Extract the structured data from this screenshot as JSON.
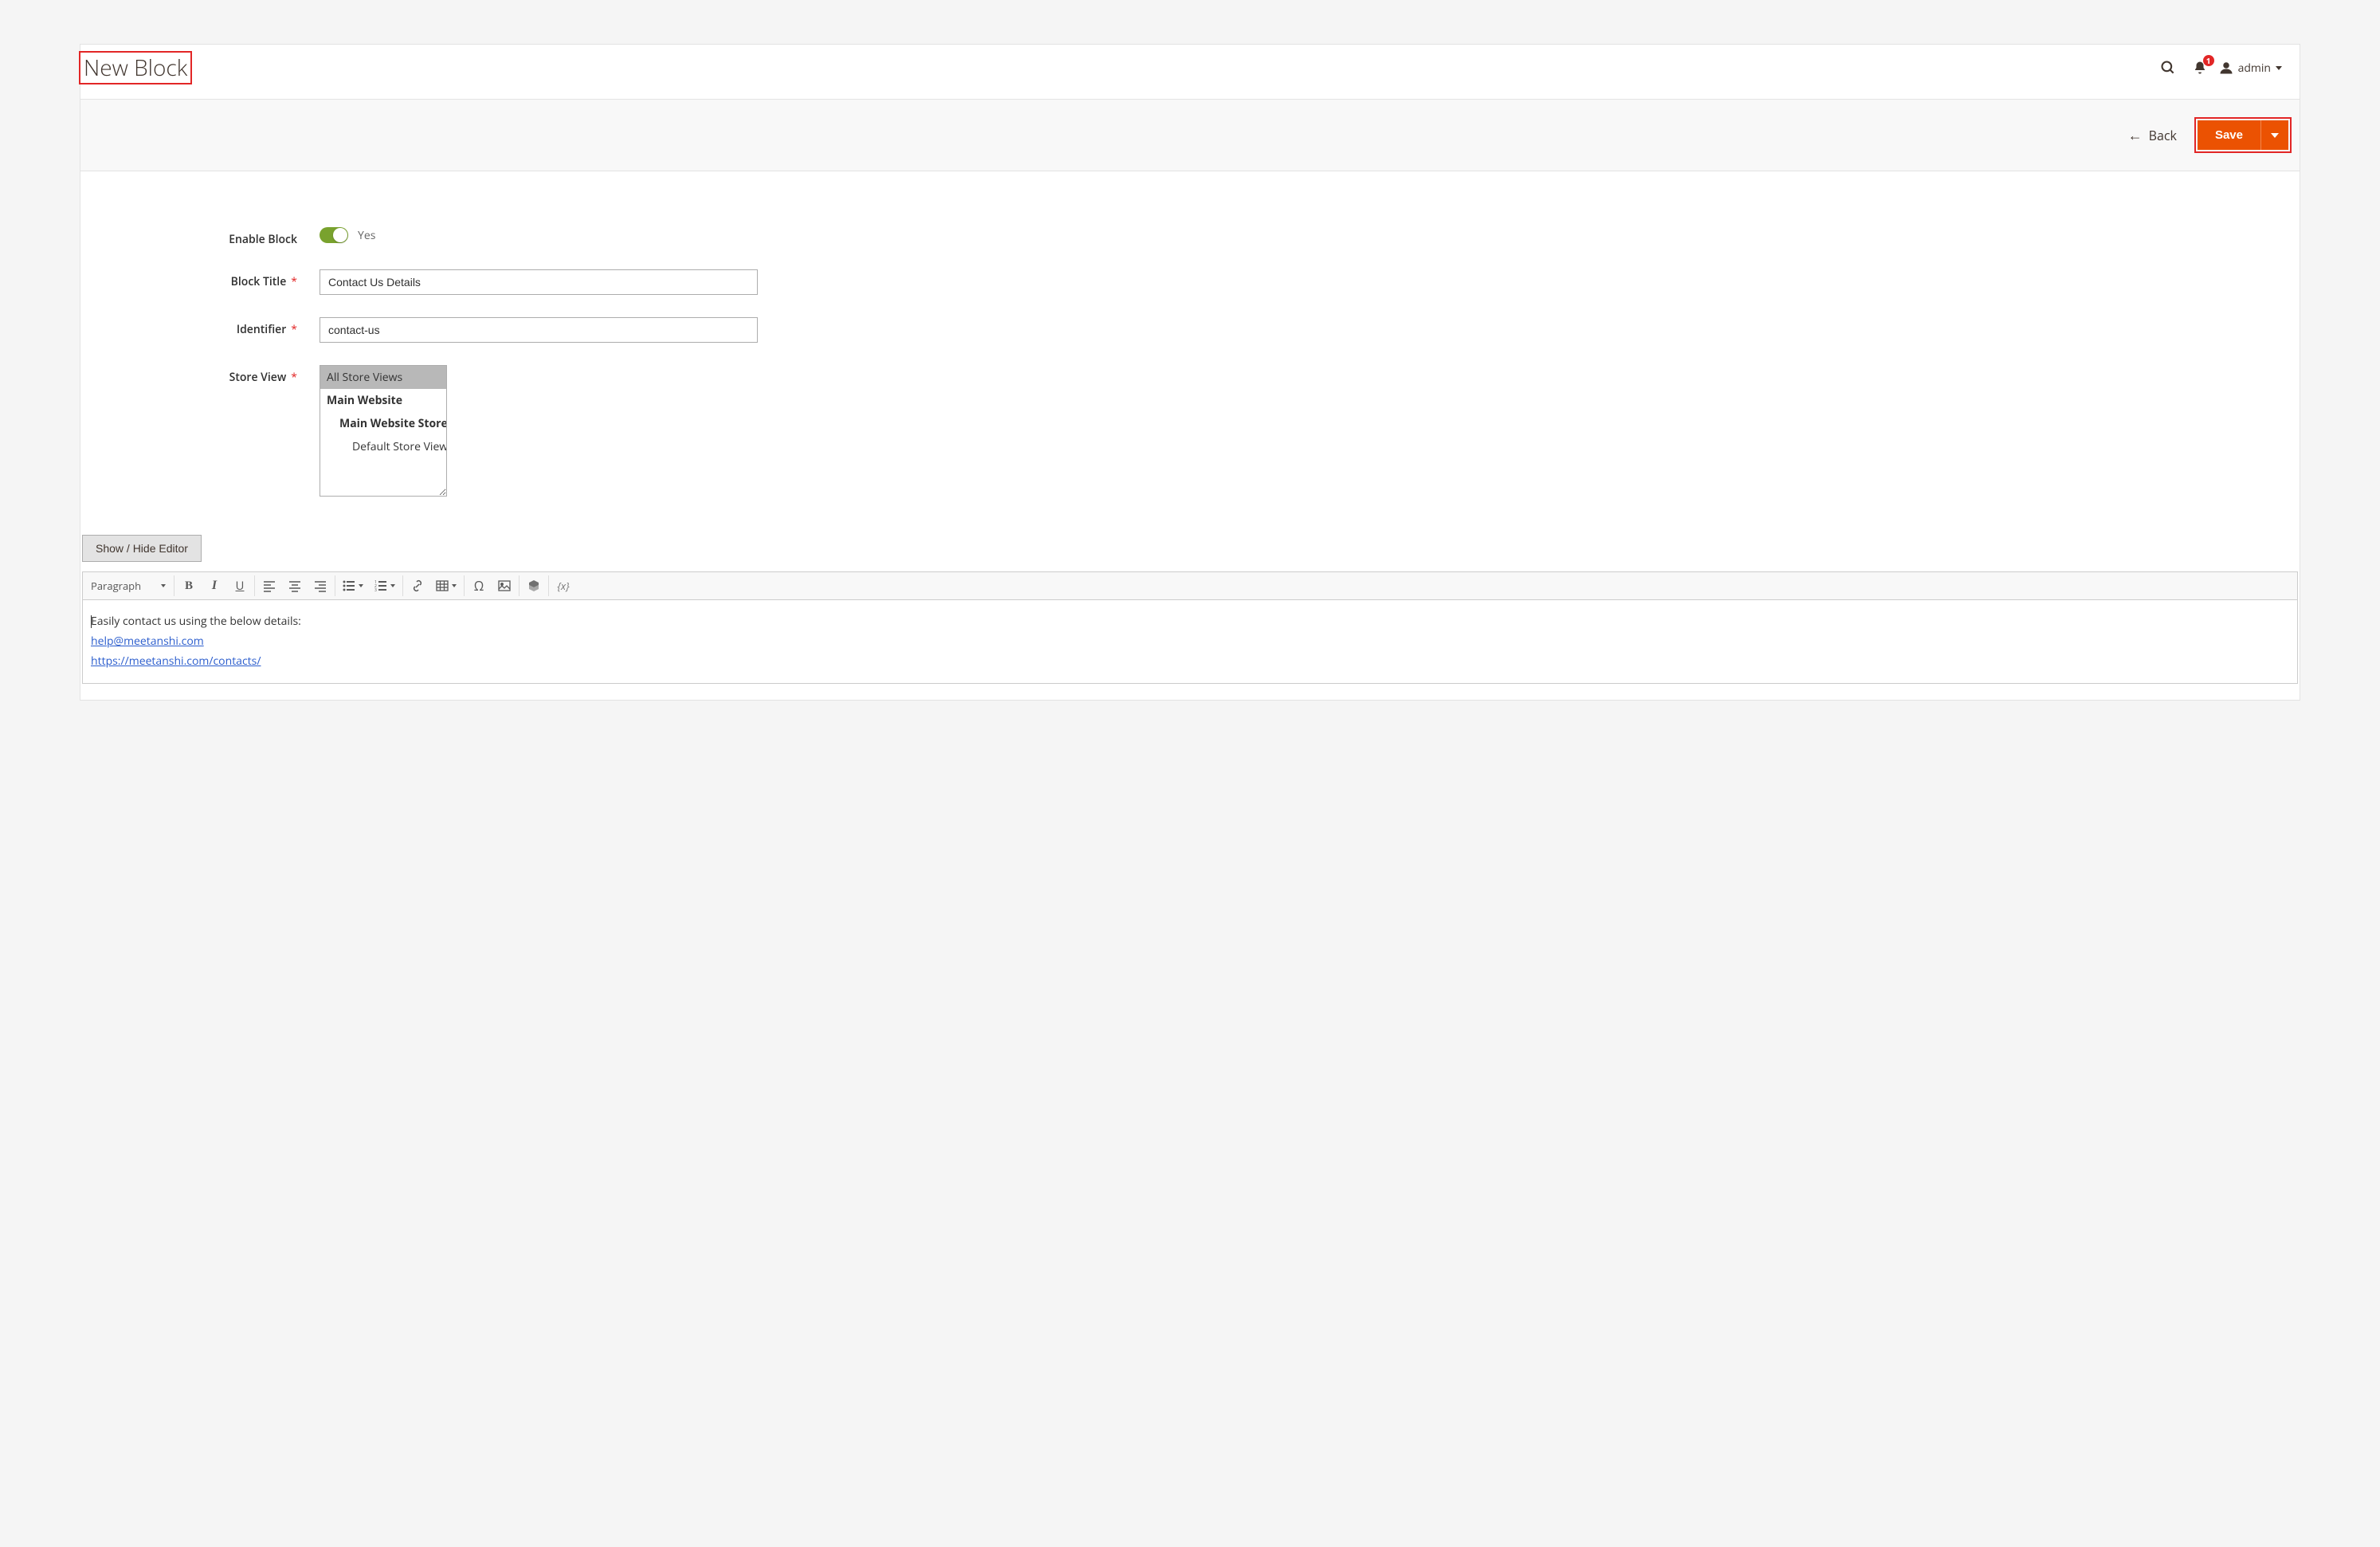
{
  "header": {
    "title": "New Block",
    "notification_count": "1",
    "user_name": "admin"
  },
  "actions": {
    "back_label": "Back",
    "save_label": "Save"
  },
  "form": {
    "enable_block_label": "Enable Block",
    "enable_block_value": "Yes",
    "block_title_label": "Block Title",
    "block_title_value": "Contact Us Details",
    "identifier_label": "Identifier",
    "identifier_value": "contact-us",
    "store_view_label": "Store View",
    "store_views": {
      "all": "All Store Views",
      "main_website": "Main Website",
      "main_website_store": "Main Website Store",
      "default_store_view": "Default Store View"
    }
  },
  "editor": {
    "show_hide_label": "Show / Hide Editor",
    "format_label": "Paragraph",
    "variable_label": "{x}",
    "content_line1": "Easily contact us using the below details:",
    "content_link1": "help@meetanshi.com",
    "content_link2": "https://meetanshi.com/contacts/"
  }
}
